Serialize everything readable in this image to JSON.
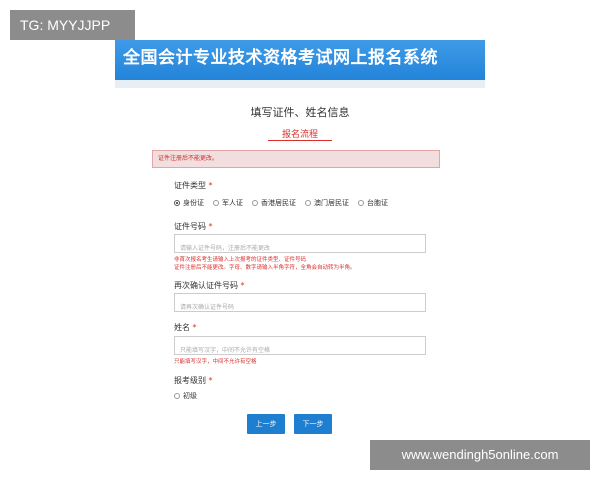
{
  "watermarks": {
    "top_left": "TG: MYYJJPP",
    "bottom_right": "www.wendingh5online.com"
  },
  "banner": {
    "title": "全国会计专业技术资格考试网上报名系统"
  },
  "page": {
    "heading": "填写证件、姓名信息",
    "process_link": "报名流程"
  },
  "alert": {
    "message": "证件注册后不能更改。"
  },
  "form": {
    "id_type": {
      "label": "证件类型",
      "required_mark": "*",
      "options": [
        "身份证",
        "军人证",
        "香港居民证",
        "澳门居民证",
        "台胞证"
      ],
      "selected": "身份证"
    },
    "id_number": {
      "label": "证件号码",
      "required_mark": "*",
      "placeholder": "请输入证件号码，注册后不能更改",
      "error_line1": "非首次报名考生请输入上次报考的证件类型、证件号码",
      "error_line2": "证件注册后不能更改。字母、数字请输入半角字符，全角会自动转为半角。"
    },
    "id_confirm": {
      "label": "再次确认证件号码",
      "required_mark": "*",
      "placeholder": "请再次确认证件号码"
    },
    "name": {
      "label": "姓名",
      "required_mark": "*",
      "placeholder": "只能填写汉字，中间不允许有空格",
      "error": "只能填写汉字，中间不允许有空格"
    },
    "level": {
      "label": "报考级别",
      "required_mark": "*",
      "options": [
        "初级"
      ]
    }
  },
  "buttons": {
    "prev": "上一步",
    "next": "下一步"
  }
}
